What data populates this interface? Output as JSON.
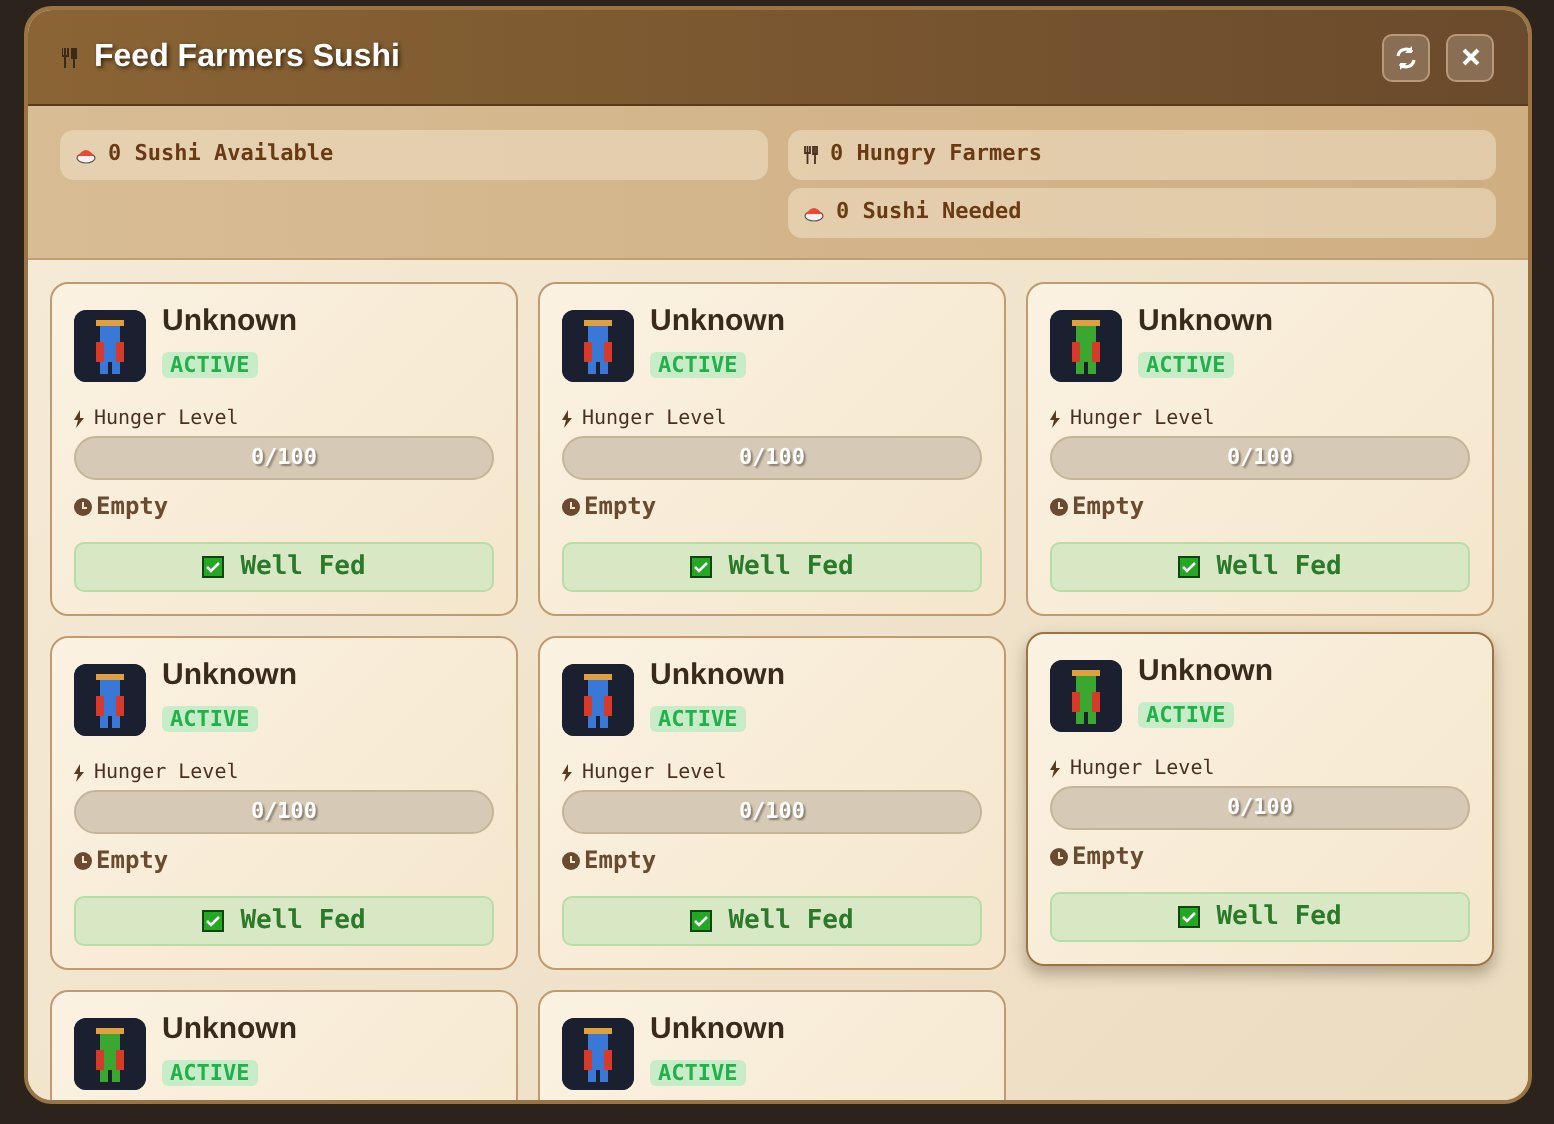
{
  "window": {
    "title": "Feed Farmers Sushi"
  },
  "stats": [
    {
      "kind": "sushi",
      "text": "0 Sushi Available"
    },
    {
      "kind": "farmers",
      "text": "0 Hungry Farmers"
    },
    {
      "kind": "sushi",
      "text": "0 Sushi Needed"
    }
  ],
  "farmers": [
    {
      "name": "Unknown",
      "status": "ACTIVE",
      "color": "#3a78d8",
      "hunger_label": "Hunger Level",
      "level": 0,
      "reading": "0/100",
      "state": "Empty",
      "button": "Well Fed",
      "checked": true,
      "raised": false
    },
    {
      "name": "Unknown",
      "status": "ACTIVE",
      "color": "#3a78d8",
      "hunger_label": "Hunger Level",
      "level": 0,
      "reading": "0/100",
      "state": "Empty",
      "button": "Well Fed",
      "checked": true,
      "raised": false
    },
    {
      "name": "Unknown",
      "status": "ACTIVE",
      "color": "#3aa830",
      "hunger_label": "Hunger Level",
      "level": 0,
      "reading": "0/100",
      "state": "Empty",
      "button": "Well Fed",
      "checked": true,
      "raised": false
    },
    {
      "name": "Unknown",
      "status": "ACTIVE",
      "color": "#3a78d8",
      "hunger_label": "Hunger Level",
      "level": 0,
      "reading": "0/100",
      "state": "Empty",
      "button": "Well Fed",
      "checked": true,
      "raised": false
    },
    {
      "name": "Unknown",
      "status": "ACTIVE",
      "color": "#3a78d8",
      "hunger_label": "Hunger Level",
      "level": 0,
      "reading": "0/100",
      "state": "Empty",
      "button": "Well Fed",
      "checked": true,
      "raised": false
    },
    {
      "name": "Unknown",
      "status": "ACTIVE",
      "color": "#3aa830",
      "hunger_label": "Hunger Level",
      "level": 0,
      "reading": "0/100",
      "state": "Empty",
      "button": "Well Fed",
      "checked": true,
      "raised": true
    },
    {
      "name": "Unknown",
      "status": "ACTIVE",
      "color": "#3aa830"
    },
    {
      "name": "Unknown",
      "status": "ACTIVE",
      "color": "#3a78d8"
    }
  ]
}
